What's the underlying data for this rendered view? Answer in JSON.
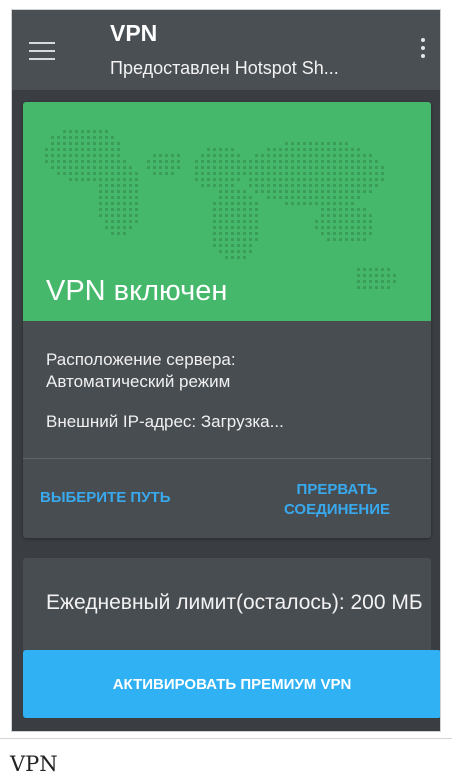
{
  "appbar": {
    "title": "VPN",
    "subtitle": "Предоставлен Hotspot Sh..."
  },
  "status_card": {
    "status_text": "VPN включен",
    "server_location_line1": "Расположение сервера:",
    "server_location_line2": "Автоматический режим",
    "external_ip": "Внешний IP-адрес: Загрузка...",
    "choose_path_label": "ВЫБЕРИТЕ ПУТЬ",
    "disconnect_line1": "ПРЕРВАТЬ",
    "disconnect_line2": "СОЕДИНЕНИЕ"
  },
  "limit_card": {
    "text": "Ежедневный лимит(осталось): 200 МБ"
  },
  "premium_button": {
    "label": "АКТИВИРОВАТЬ ПРЕМИУМ VPN"
  },
  "caption": "VPN",
  "colors": {
    "appbar": "#4a4f54",
    "background": "#3a3e42",
    "card": "#484d52",
    "hero_green": "#46b86b",
    "accent_blue": "#39a9ee",
    "premium_blue": "#2fb1f4"
  },
  "icons": [
    "menu-icon",
    "overflow-icon",
    "world-map"
  ]
}
